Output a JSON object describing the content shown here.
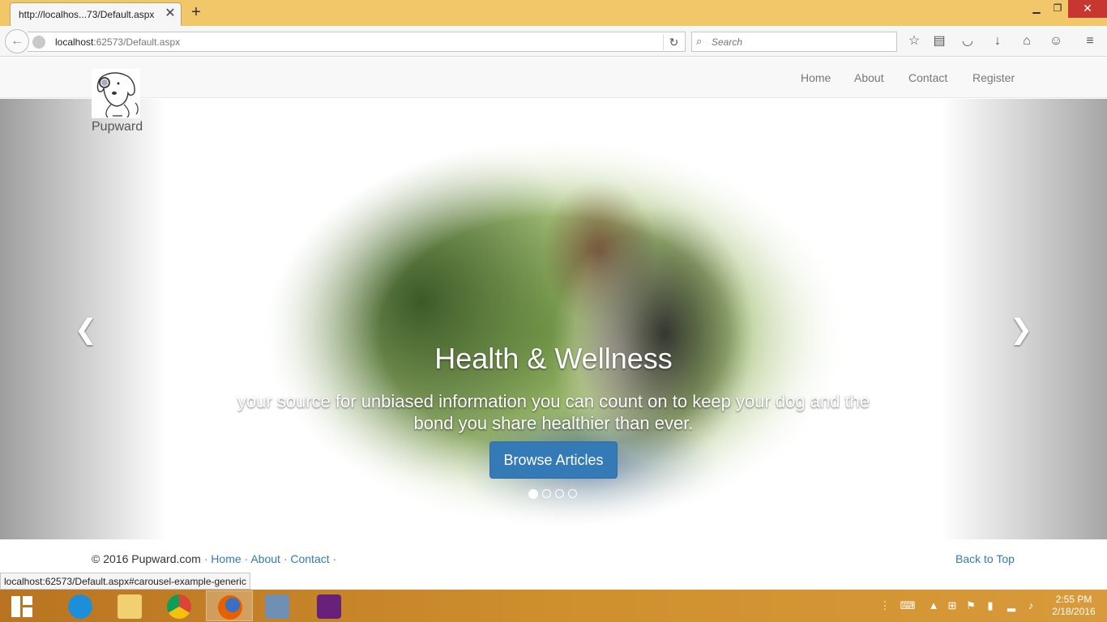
{
  "browser": {
    "tab_title": "http://localhos...73/Default.aspx",
    "url_host": "localhost",
    "url_rest": ":62573/Default.aspx",
    "search_placeholder": "Search",
    "status_url": "localhost:62573/Default.aspx#carousel-example-generic"
  },
  "site": {
    "brand": "Pupward",
    "nav": [
      "Home",
      "About",
      "Contact",
      "Register"
    ]
  },
  "carousel": {
    "title": "Health & Wellness",
    "text": "your source for unbiased information you can count on to keep your dog and the bond you share healthier than ever.",
    "button": "Browse Articles",
    "slide_count": 4,
    "active_index": 0
  },
  "footer": {
    "copyright": "© 2016 Pupward.com",
    "links": [
      "Home",
      "About",
      "Contact"
    ],
    "back_to_top": "Back to Top"
  },
  "taskbar": {
    "apps": [
      "internet-explorer",
      "file-explorer",
      "chrome",
      "firefox",
      "virtualbox",
      "visual-studio"
    ],
    "active_app": "firefox",
    "time": "2:55 PM",
    "date": "2/18/2016"
  },
  "colors": {
    "titlebar": "#f1c76a",
    "link": "#337ab7",
    "button": "#337ab7",
    "taskbar": "#cf8f2d"
  }
}
